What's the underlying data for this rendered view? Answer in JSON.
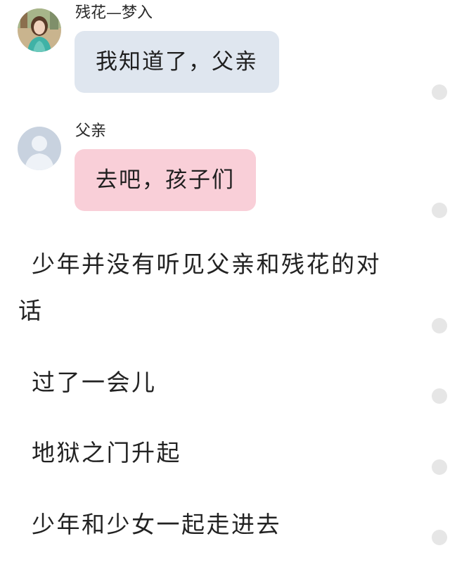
{
  "messages": [
    {
      "sender": "残花—梦入",
      "text": "我知道了，父亲",
      "avatar": "girl-portrait-avatar",
      "bubble_color": "#dfe6ef"
    },
    {
      "sender": "父亲",
      "text": "去吧，孩子们",
      "avatar": "default-person-avatar",
      "bubble_color": "#f9cfd8"
    }
  ],
  "narration": {
    "line1": "少年并没有听见父亲和残花的对",
    "line1_cont": "话",
    "line2": "过了一会儿",
    "line3": "地狱之门升起",
    "line4": "少年和少女一起走进去"
  },
  "colors": {
    "bubble_blue": "#dfe6ef",
    "bubble_pink": "#f9cfd8",
    "dot_gray": "#e6e6e6",
    "default_avatar_bg": "#c8d2df"
  }
}
